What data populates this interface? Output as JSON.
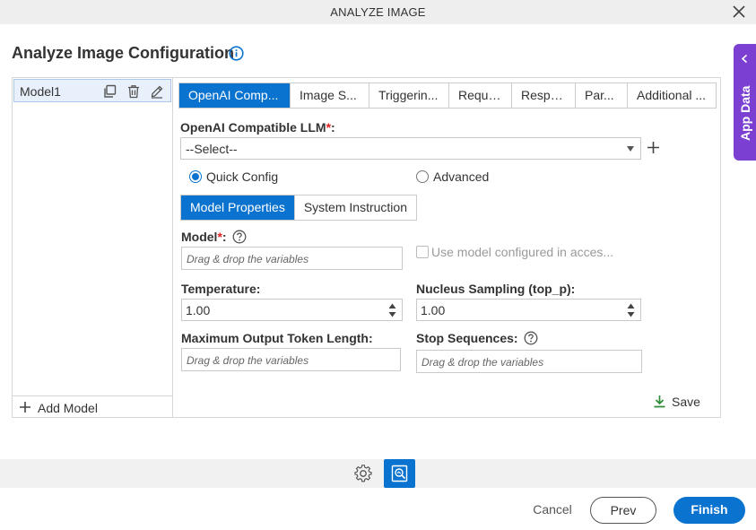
{
  "window": {
    "title": "ANALYZE IMAGE"
  },
  "page": {
    "heading": "Analyze Image Configuration"
  },
  "side_tab": {
    "label": "App Data"
  },
  "models": {
    "items": [
      {
        "name": "Model1"
      }
    ],
    "add_label": "Add Model"
  },
  "tabs": [
    {
      "label": "OpenAI Comp..."
    },
    {
      "label": "Image S..."
    },
    {
      "label": "Triggerin..."
    },
    {
      "label": "Reque..."
    },
    {
      "label": "Respo..."
    },
    {
      "label": "Par..."
    },
    {
      "label": "Additional ..."
    }
  ],
  "form": {
    "llm_label": "OpenAI Compatible LLM",
    "required_mark": "*",
    "label_suffix": ":",
    "llm_value": "--Select--",
    "radio_quick": "Quick Config",
    "radio_advanced": "Advanced",
    "selected_mode": "Quick Config",
    "subtab_model": "Model Properties",
    "subtab_system": "System Instruction",
    "model_label": "Model",
    "drop_placeholder": "Drag & drop the variables",
    "use_model_label": "Use model configured in acces...",
    "temperature_label": "Temperature:",
    "temperature_value": "1.00",
    "top_p_label": "Nucleus Sampling (top_p):",
    "top_p_value": "1.00",
    "max_tokens_label": "Maximum Output Token Length:",
    "stop_label": "Stop Sequences:",
    "save_label": "Save"
  },
  "footer": {
    "cancel": "Cancel",
    "prev": "Prev",
    "finish": "Finish"
  },
  "colors": {
    "primary": "#0a73cf",
    "app_data": "#7b3fd1",
    "required": "#e02020",
    "save_icon": "#2e8b3a"
  }
}
